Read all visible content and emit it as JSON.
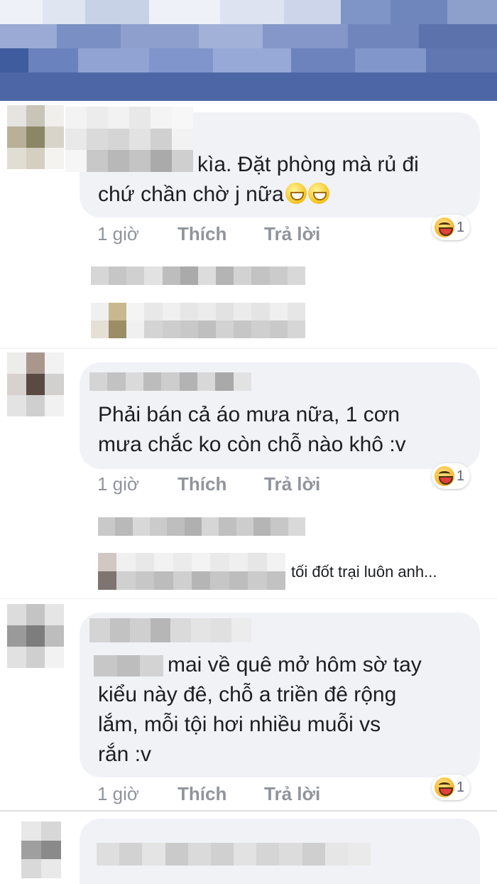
{
  "comments": [
    {
      "text_lines": [
        "kìa. Đặt  phòng mà rủ đi",
        "chứ chần chờ j nữa"
      ],
      "time": "1 giờ",
      "like": "Thích",
      "reply": "Trả lời",
      "reaction_count": "1"
    },
    {
      "text_lines": [
        "Phải bán cả áo mưa nữa, 1 cơn",
        "mưa  chắc ko còn chỗ nào khô :v"
      ],
      "time": "1 giờ",
      "like": "Thích",
      "reply": "Trả lời",
      "reaction_count": "1",
      "reply_preview": "tối đốt trại luôn anh..."
    },
    {
      "text_lines": [
        "mai về quê mở hôm sờ tay",
        "kiểu này đê, chỗ a triền đê rộng",
        "lắm, mỗi tội hơi nhiều muỗi vs",
        "rắn :v"
      ],
      "time": "1 giờ",
      "like": "Thích",
      "reply": "Trả lời",
      "reaction_count": "1"
    }
  ],
  "icons": {
    "reaction": "haha-reaction-icon",
    "inline_emoji": "laughing-emoji-icon"
  },
  "colors": {
    "bubble": "#f1f2f6",
    "meta": "#90949c",
    "text": "#1c1e21",
    "header": "#5b74ad"
  }
}
